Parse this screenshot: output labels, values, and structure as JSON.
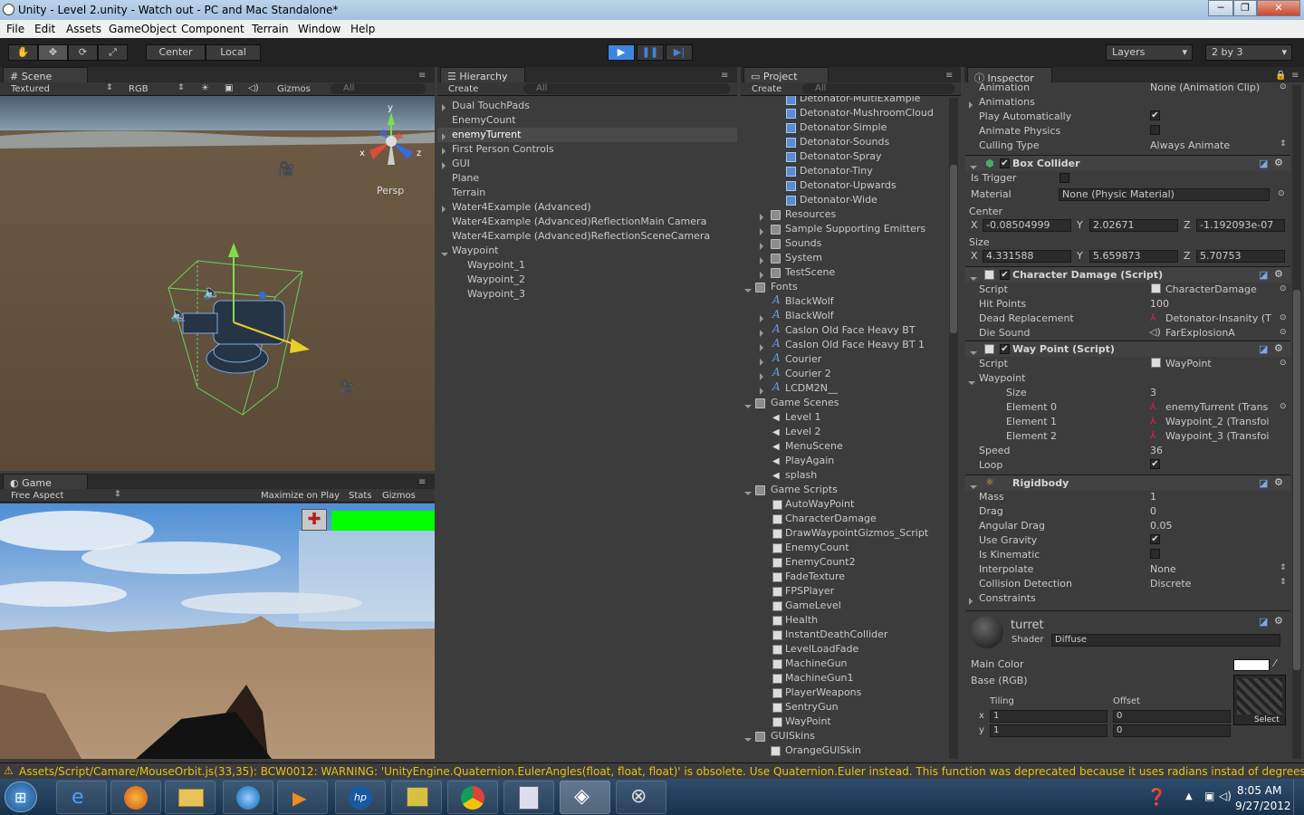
{
  "window": {
    "title": "Unity - Level 2.unity - Watch out - PC and Mac Standalone*"
  },
  "menu": [
    "File",
    "Edit",
    "Assets",
    "GameObject",
    "Component",
    "Terrain",
    "Window",
    "Help"
  ],
  "toolbar": {
    "center_label": "Center",
    "local_label": "Local",
    "layers_label": "Layers",
    "layout_label": "2 by 3"
  },
  "scene": {
    "tab": "Scene",
    "mode": "Textured",
    "rgb": "RGB",
    "gizmos": "Gizmos",
    "search_placeholder": "All",
    "persp": "Persp",
    "axis_x": "x",
    "axis_y": "y",
    "axis_z": "z"
  },
  "game": {
    "tab": "Game",
    "aspect": "Free Aspect",
    "maximize": "Maximize on Play",
    "stats": "Stats",
    "gizmos": "Gizmos"
  },
  "hierarchy": {
    "tab": "Hierarchy",
    "create": "Create",
    "search_placeholder": "All",
    "items": [
      "Dual TouchPads",
      "EnemyCount",
      "enemyTurrent",
      "First Person Controls",
      "GUI",
      "Plane",
      "Terrain",
      "Water4Example (Advanced)",
      "Water4Example (Advanced)ReflectionMain Camera",
      "Water4Example (Advanced)ReflectionSceneCamera",
      "Waypoint",
      "Waypoint_1",
      "Waypoint_2",
      "Waypoint_3"
    ]
  },
  "project": {
    "tab": "Project",
    "create": "Create",
    "search_placeholder": "All",
    "items": [
      "Detonator-MultiExample",
      "Detonator-MushroomCloud",
      "Detonator-Simple",
      "Detonator-Sounds",
      "Detonator-Spray",
      "Detonator-Tiny",
      "Detonator-Upwards",
      "Detonator-Wide",
      "Resources",
      "Sample Supporting Emitters",
      "Sounds",
      "System",
      "TestScene",
      "Fonts",
      "BlackWolf",
      "BlackWolf",
      "Caslon Old Face Heavy BT",
      "Caslon Old Face Heavy BT 1",
      "Courier",
      "Courier 2",
      "LCDM2N__",
      "Game Scenes",
      "Level 1",
      "Level 2",
      "MenuScene",
      "PlayAgain",
      "splash",
      "Game Scripts",
      "AutoWayPoint",
      "CharacterDamage",
      "DrawWaypointGizmos_Script",
      "EnemyCount",
      "EnemyCount2",
      "FadeTexture",
      "FPSPlayer",
      "GameLevel",
      "Health",
      "InstantDeathCollider",
      "LevelLoadFade",
      "MachineGun",
      "MachineGun1",
      "PlayerWeapons",
      "SentryGun",
      "WayPoint",
      "GUISkins",
      "OrangeGUISkin"
    ]
  },
  "inspector": {
    "tab": "Inspector",
    "top_rows": [
      {
        "label": "Animation",
        "value": "None (Animation Clip)"
      },
      {
        "label": "Animations",
        "value": ""
      },
      {
        "label": "Play Automatically",
        "value": "checked"
      },
      {
        "label": "Animate Physics",
        "value": ""
      },
      {
        "label": "Culling Type",
        "value": "Always Animate"
      }
    ],
    "box_collider": {
      "title": "Box Collider",
      "is_trigger": "Is Trigger",
      "material": "Material",
      "material_value": "None (Physic Material)",
      "center": "Center",
      "size": "Size",
      "center_x": "-0.08504999",
      "center_y": "2.02671",
      "center_z": "-1.192093e-07",
      "size_x": "4.331588",
      "size_y": "5.659873",
      "size_z": "5.70753",
      "x": "X",
      "y": "Y",
      "z": "Z"
    },
    "character_damage": {
      "title": "Character Damage (Script)",
      "rows": [
        {
          "label": "Script",
          "value": "CharacterDamage"
        },
        {
          "label": "Hit Points",
          "value": "100"
        },
        {
          "label": "Dead Replacement",
          "value": "Detonator-Insanity (T"
        },
        {
          "label": "Die Sound",
          "value": "FarExplosionA"
        }
      ]
    },
    "way_point": {
      "title": "Way Point (Script)",
      "rows": [
        {
          "label": "Script",
          "value": "WayPoint"
        },
        {
          "label": "Waypoint",
          "value": ""
        },
        {
          "label": "Size",
          "value": "3"
        },
        {
          "label": "Element 0",
          "value": "enemyTurrent (Trans"
        },
        {
          "label": "Element 1",
          "value": "Waypoint_2 (Transfoi"
        },
        {
          "label": "Element 2",
          "value": "Waypoint_3 (Transfoi"
        },
        {
          "label": "Speed",
          "value": "36"
        },
        {
          "label": "Loop",
          "value": "checked"
        }
      ]
    },
    "rigidbody": {
      "title": "Rigidbody",
      "rows": [
        {
          "label": "Mass",
          "value": "1"
        },
        {
          "label": "Drag",
          "value": "0"
        },
        {
          "label": "Angular Drag",
          "value": "0.05"
        },
        {
          "label": "Use Gravity",
          "value": "checked"
        },
        {
          "label": "Is Kinematic",
          "value": ""
        },
        {
          "label": "Interpolate",
          "value": "None"
        },
        {
          "label": "Collision Detection",
          "value": "Discrete"
        },
        {
          "label": "Constraints",
          "value": ""
        }
      ]
    },
    "material": {
      "name": "turret",
      "shader_label": "Shader",
      "shader": "Diffuse",
      "main_color": "Main Color",
      "base": "Base (RGB)",
      "tiling": "Tiling",
      "offset": "Offset",
      "tx": "1",
      "ty": "1",
      "ox": "0",
      "oy": "0",
      "x": "x",
      "y": "y",
      "select": "Select"
    }
  },
  "status": {
    "message": "Assets/Script/Camare/MouseOrbit.js(33,35): BCW0012: WARNING: 'UnityEngine.Quaternion.EulerAngles(float, float, float)' is obsolete. Use Quaternion.Euler instead. This function was deprecated because it uses radians instad of degrees"
  },
  "clock": {
    "time": "8:05 AM",
    "date": "9/27/2012"
  },
  "colors": {
    "accent": "#3d86e0",
    "health": "#00ff00",
    "warning": "#e6c21a"
  }
}
